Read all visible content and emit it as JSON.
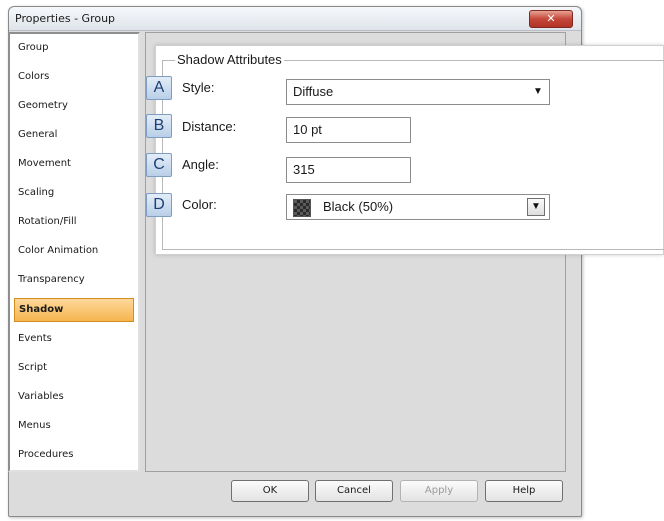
{
  "window": {
    "title": "Properties - Group",
    "close_glyph": "✕"
  },
  "nav": {
    "items": [
      {
        "label": "Group"
      },
      {
        "label": "Colors"
      },
      {
        "label": "Geometry"
      },
      {
        "label": "General"
      },
      {
        "label": "Movement"
      },
      {
        "label": "Scaling"
      },
      {
        "label": "Rotation/Fill"
      },
      {
        "label": "Color Animation"
      },
      {
        "label": "Transparency"
      },
      {
        "label": "Shadow",
        "selected": true
      },
      {
        "label": "Events"
      },
      {
        "label": "Script"
      },
      {
        "label": "Variables"
      },
      {
        "label": "Menus"
      },
      {
        "label": "Procedures"
      }
    ]
  },
  "buttons": {
    "ok": "OK",
    "cancel": "Cancel",
    "apply": "Apply",
    "help": "Help"
  },
  "shadow": {
    "group_title": "Shadow Attributes",
    "style": {
      "badge": "A",
      "label": "Style:",
      "value": "Diffuse"
    },
    "distance": {
      "badge": "B",
      "label": "Distance:",
      "value": "10 pt"
    },
    "angle": {
      "badge": "C",
      "label": "Angle:",
      "value": "315"
    },
    "color": {
      "badge": "D",
      "label": "Color:",
      "value": "Black (50%)"
    },
    "dropdown_glyph": "▼"
  },
  "colors": {
    "selected_item": "#f5b54f",
    "badge_text": "#1d3f73",
    "close_button": "#c4473a"
  }
}
